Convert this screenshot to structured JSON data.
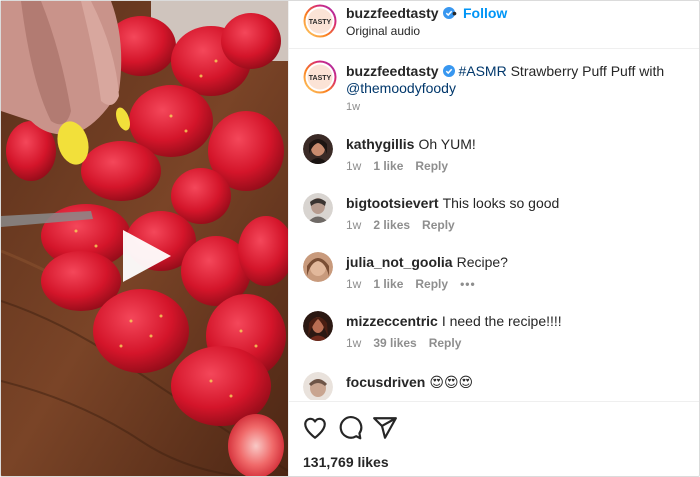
{
  "header": {
    "username": "buzzfeedtasty",
    "separator": "•",
    "follow_label": "Follow",
    "audio_label": "Original audio",
    "avatar_text": "TASTY"
  },
  "caption": {
    "username": "buzzfeedtasty",
    "hashtag": "#ASMR",
    "text": " Strawberry Puff Puff with",
    "mention": "@themoodyfoody",
    "time": "1w"
  },
  "comments": [
    {
      "username": "kathygillis",
      "text": "Oh YUM!",
      "time": "1w",
      "likes": "1 like",
      "reply": "Reply",
      "more": ""
    },
    {
      "username": "bigtootsievert",
      "text": "This looks so good",
      "time": "1w",
      "likes": "2 likes",
      "reply": "Reply",
      "more": ""
    },
    {
      "username": "julia_not_goolia",
      "text": "Recipe?",
      "time": "1w",
      "likes": "1 like",
      "reply": "Reply",
      "more": "•••"
    },
    {
      "username": "mizzeccentric",
      "text": "I need the recipe!!!!",
      "time": "1w",
      "likes": "39 likes",
      "reply": "Reply",
      "more": ""
    },
    {
      "username": "focusdriven",
      "text": "😍😍😍",
      "time": "",
      "likes": "",
      "reply": "",
      "more": ""
    }
  ],
  "footer": {
    "likes_count": "131,769 likes"
  },
  "colors": {
    "follow_blue": "#0095f6",
    "link_blue": "#00376b",
    "muted": "#8e8e8e",
    "text": "#262626",
    "verified": "#3897f0"
  },
  "icons": [
    "play-icon",
    "verified-badge-icon",
    "heart-icon",
    "comment-icon",
    "share-icon"
  ]
}
